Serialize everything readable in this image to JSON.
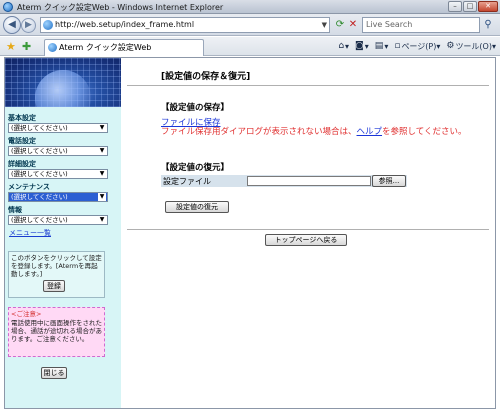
{
  "window": {
    "title": "Aterm クイック設定Web - Windows Internet Explorer",
    "minimize": "–",
    "maximize": "□",
    "close": "✕"
  },
  "browser": {
    "url": "http://web.setup/index_frame.html",
    "search_placeholder": "Live Search",
    "tab_label": "Aterm クイック設定Web",
    "commands": {
      "home": "",
      "feeds": "",
      "print": "",
      "page": "ページ(P)",
      "tools": "ツール(O)"
    },
    "icons": {
      "back": "back-arrow-icon",
      "forward": "forward-arrow-icon",
      "refresh": "refresh-icon",
      "stop": "stop-icon",
      "search": "magnifier-icon",
      "favorites": "star-icon",
      "add_favorites": "add-favorite-icon",
      "home": "home-icon",
      "feeds": "rss-icon",
      "print": "printer-icon",
      "page": "page-icon",
      "tools": "gear-icon"
    }
  },
  "sidebar": {
    "groups": [
      {
        "label": "基本設定",
        "value": "(選択してください)"
      },
      {
        "label": "電話設定",
        "value": "(選択してください)"
      },
      {
        "label": "詳細設定",
        "value": "(選択してください)"
      },
      {
        "label": "メンテナンス",
        "value": "(選択してください)"
      },
      {
        "label": "情報",
        "value": "(選択してください)"
      }
    ],
    "menu_list": "メニュー一覧",
    "info_text": "このボタンをクリックして設定を登録します。[Atermを再起動します。]",
    "register_button": "登録",
    "caution_title": "<ご注意>",
    "caution_text": "電話使用中に画面操作をされた場合、通話が途切れる場合があります。ご注意ください。",
    "close_button": "閉じる"
  },
  "main": {
    "title": "[設定値の保存＆復元]",
    "save_heading": "【設定値の保存】",
    "save_link": "ファイルに保存",
    "save_note_before": "ファイル保存用ダイアログが表示されない場合は、",
    "save_note_help": "ヘルプ",
    "save_note_after": "を参照してください。",
    "restore_heading": "【設定値の復元】",
    "file_label": "設定ファイル",
    "browse_button": "参照...",
    "restore_button": "設定値の復元",
    "top_button": "トップページへ戻る"
  },
  "colors": {
    "sidebar_bg": "#d7f5f6",
    "link": "#1a35d8",
    "note_red": "#e03030",
    "caution_bg": "#ffd9f5",
    "selected_bg": "#2c5fd3"
  }
}
